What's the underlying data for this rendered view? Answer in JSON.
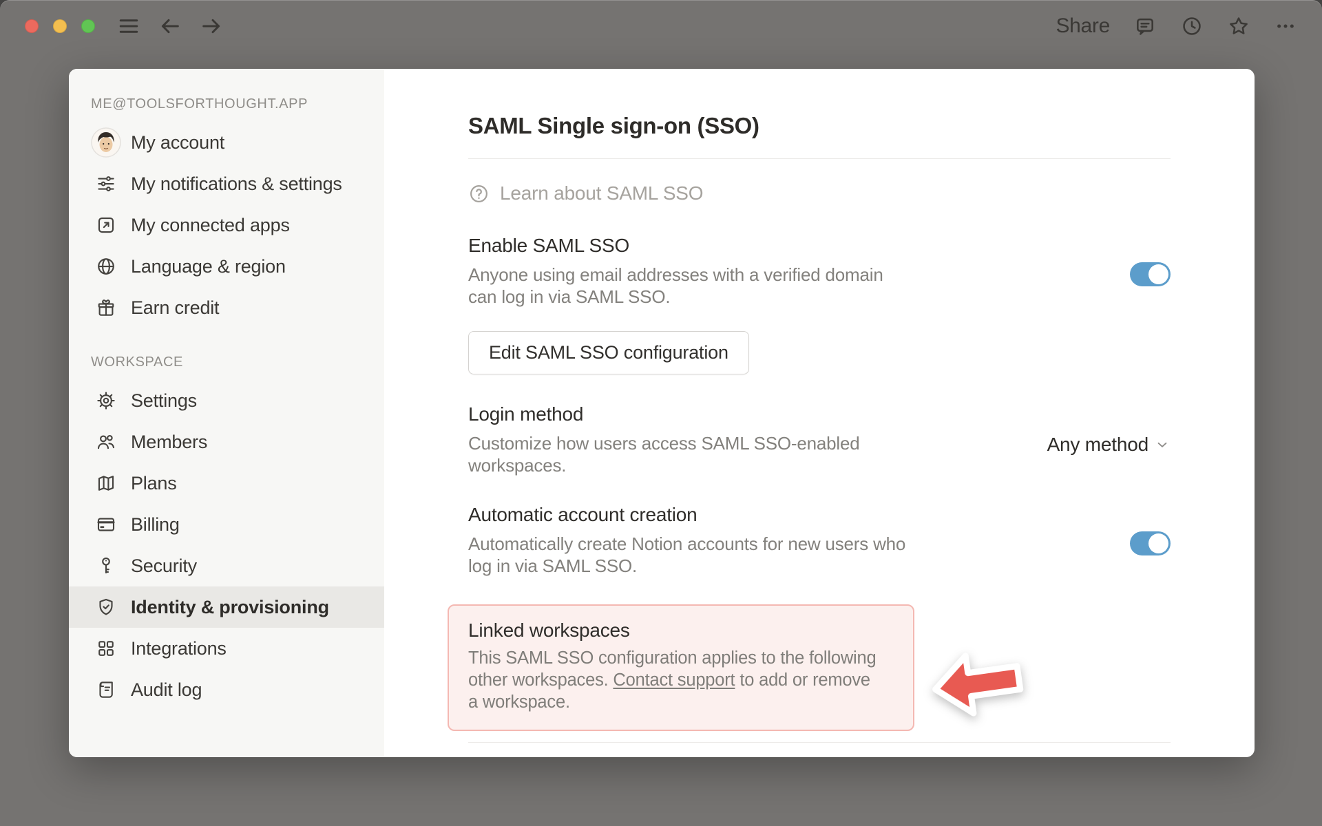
{
  "window": {
    "titlebar": {
      "share_label": "Share",
      "right_icons": [
        "comment-icon",
        "clock-icon",
        "star-icon",
        "ellipsis-icon"
      ]
    }
  },
  "sidebar": {
    "account_header": "ME@TOOLSFORTHOUGHT.APP",
    "account_items": [
      {
        "label": "My account",
        "icon": "avatar"
      },
      {
        "label": "My notifications & settings",
        "icon": "sliders"
      },
      {
        "label": "My connected apps",
        "icon": "arrow-up-right-box"
      },
      {
        "label": "Language & region",
        "icon": "globe"
      },
      {
        "label": "Earn credit",
        "icon": "gift"
      }
    ],
    "workspace_header": "WORKSPACE",
    "workspace_items": [
      {
        "label": "Settings",
        "icon": "gear"
      },
      {
        "label": "Members",
        "icon": "members"
      },
      {
        "label": "Plans",
        "icon": "map"
      },
      {
        "label": "Billing",
        "icon": "credit-card"
      },
      {
        "label": "Security",
        "icon": "key"
      },
      {
        "label": "Identity & provisioning",
        "icon": "shield-check",
        "selected": true
      },
      {
        "label": "Integrations",
        "icon": "grid"
      },
      {
        "label": "Audit log",
        "icon": "scroll"
      }
    ]
  },
  "main": {
    "title": "SAML Single sign-on (SSO)",
    "learn_link": "Learn about SAML SSO",
    "enable": {
      "title": "Enable SAML SSO",
      "description": "Anyone using email addresses with a verified domain can log in via SAML SSO.",
      "toggle_on": true
    },
    "edit_button_label": "Edit SAML SSO configuration",
    "login_method": {
      "title": "Login method",
      "description": "Customize how users access SAML SSO-enabled workspaces.",
      "value": "Any method"
    },
    "auto_account": {
      "title": "Automatic account creation",
      "description": "Automatically create Notion accounts for new users who log in via SAML SSO.",
      "toggle_on": true
    },
    "linked_workspaces": {
      "title": "Linked workspaces",
      "description_before": "This SAML SSO configuration applies to the following other workspaces. ",
      "link_text": "Contact support",
      "description_after": " to add or remove a workspace."
    }
  },
  "colors": {
    "accent_blue": "#5c9dcb",
    "highlight_bg": "#fcf0ee",
    "highlight_border": "#f4b8b2",
    "arrow_red": "#e85a52",
    "window_gray": "#757371",
    "sidebar_bg": "#f7f7f5"
  }
}
